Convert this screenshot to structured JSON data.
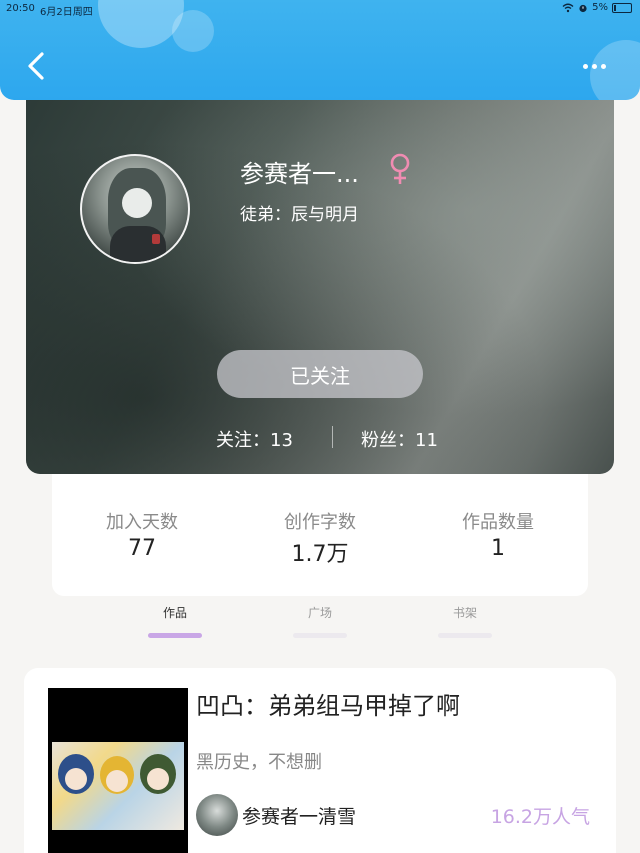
{
  "status_bar": {
    "time": "20:50",
    "date": "6月2日周四",
    "battery": "5%"
  },
  "header": {
    "back_icon": "chevron-left-icon",
    "more_icon": "more-dots-icon"
  },
  "profile": {
    "name": "参赛者一...",
    "gender_symbol": "♀",
    "apprentice": "徒弟：辰与明月",
    "follow_button": "已关注",
    "following": "关注：13",
    "fans": "粉丝：11"
  },
  "stats": [
    {
      "label": "加入天数",
      "value": "77"
    },
    {
      "label": "创作字数",
      "value": "1.7万"
    },
    {
      "label": "作品数量",
      "value": "1"
    }
  ],
  "tabs": [
    {
      "label": "作品",
      "active": true
    },
    {
      "label": "广场",
      "active": false
    },
    {
      "label": "书架",
      "active": false
    }
  ],
  "works": [
    {
      "title": "凹凸：弟弟组马甲掉了啊",
      "description": "黑历史，不想删",
      "author": "参赛者一清雪",
      "popularity": "16.2万人气"
    }
  ],
  "colors": {
    "header_blue": "#2da7ee",
    "accent_purple": "#c9a6e6",
    "gender_pink": "#f08cb2"
  }
}
